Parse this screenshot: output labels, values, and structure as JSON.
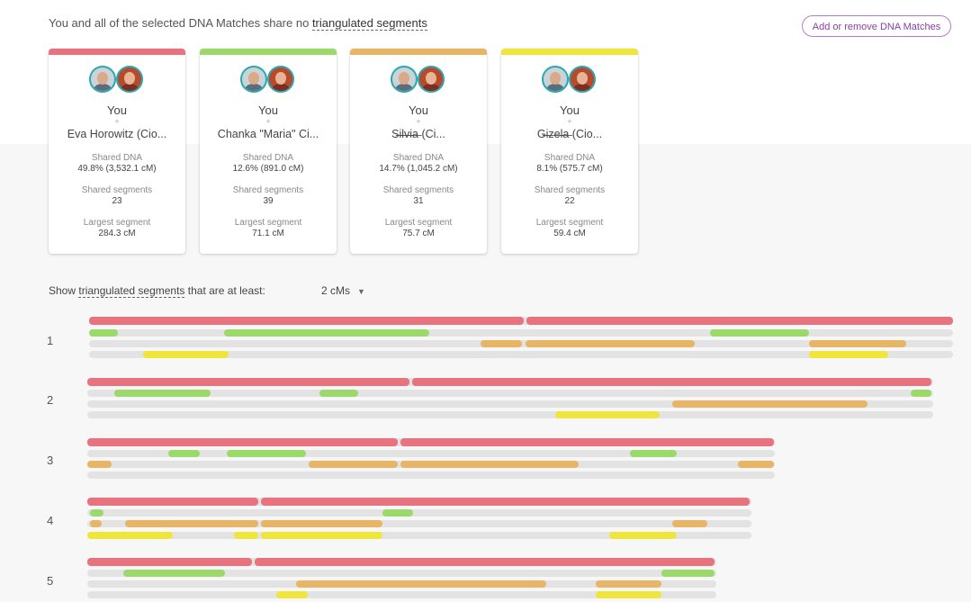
{
  "header": {
    "text_before": "You and all of the selected DNA Matches share no ",
    "link_text": "triangulated segments",
    "add_button": "Add or remove DNA Matches"
  },
  "cards": [
    {
      "color": "#e8737f",
      "you": "You",
      "plus": "+",
      "name": "Eva Horowitz (Cio...",
      "shared_dna_label": "Shared DNA",
      "shared_dna": "49.8% (3,532.1 cM)",
      "segments_label": "Shared segments",
      "segments": "23",
      "largest_label": "Largest segment",
      "largest": "284.3 cM"
    },
    {
      "color": "#9bd96a",
      "you": "You",
      "plus": "+",
      "name": "Chanka \"Maria\" Ci...",
      "shared_dna_label": "Shared DNA",
      "shared_dna": "12.6% (891.0 cM)",
      "segments_label": "Shared segments",
      "segments": "39",
      "largest_label": "Largest segment",
      "largest": "71.1 cM"
    },
    {
      "color": "#e8b466",
      "you": "You",
      "plus": "+",
      "name": "S̶i̶l̶v̶i̶a̶ (Ci...",
      "shared_dna_label": "Shared DNA",
      "shared_dna": "14.7% (1,045.2 cM)",
      "segments_label": "Shared segments",
      "segments": "31",
      "largest_label": "Largest segment",
      "largest": "75.7 cM"
    },
    {
      "color": "#f0e63a",
      "you": "You",
      "plus": "+",
      "name": "G̶i̶z̶e̶l̶a̶ (Cio...",
      "shared_dna_label": "Shared DNA",
      "shared_dna": "8.1% (575.7 cM)",
      "segments_label": "Shared segments",
      "segments": "22",
      "largest_label": "Largest segment",
      "largest": "59.4 cM"
    }
  ],
  "filter": {
    "text_before": "Show ",
    "link_text": "triangulated segments",
    "text_after": " that are at least:",
    "selected": "2 cMs"
  },
  "colors": {
    "red": "#e8737f",
    "green": "#9bd96a",
    "orange": "#e8b466",
    "yellow": "#f0e63a",
    "track": "#e3e3e3"
  },
  "chromosomes": [
    {
      "label": "1"
    },
    {
      "label": "2"
    },
    {
      "label": "3"
    },
    {
      "label": "4"
    },
    {
      "label": "5"
    }
  ]
}
